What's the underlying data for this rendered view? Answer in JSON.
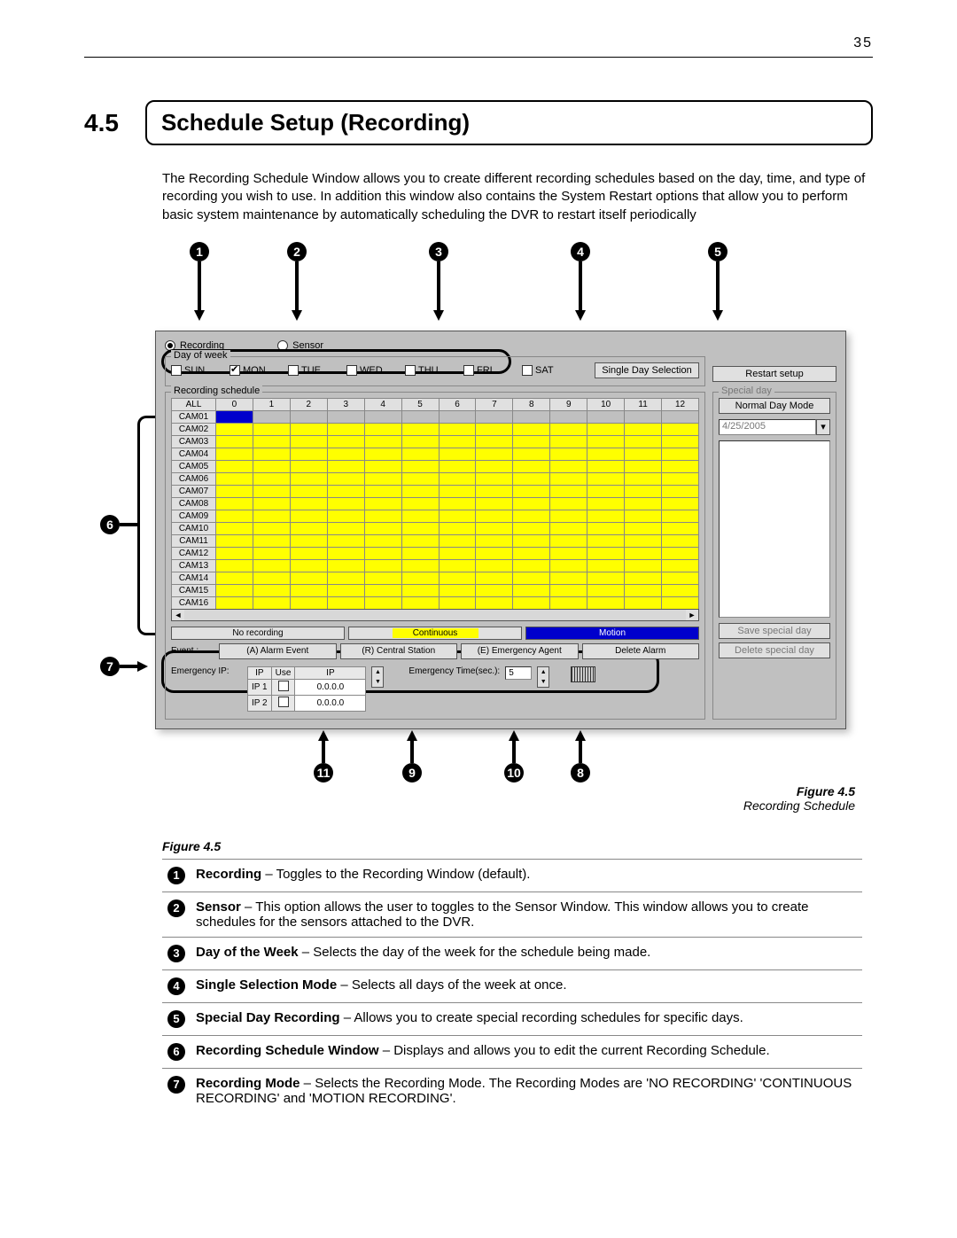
{
  "page_number": "35",
  "section_number": "4.5",
  "section_title": "Schedule Setup (Recording)",
  "intro": "The Recording Schedule Window allows you to create different recording schedules based on the day, time, and type of recording you wish to use. In addition this window also contains the System Restart options that allow you to perform basic system maintenance by automatically scheduling the DVR to restart itself periodically",
  "callout_nums_top": {
    "c1": "1",
    "c2": "2",
    "c3": "3",
    "c4": "4",
    "c5": "5"
  },
  "callout_nums_left": {
    "c6": "6",
    "c7": "7"
  },
  "callout_nums_bottom": {
    "c11": "11",
    "c9": "9",
    "c10": "10",
    "c8": "8"
  },
  "window": {
    "radio_recording": "Recording",
    "radio_sensor": "Sensor",
    "group_day": "Day of week",
    "days": {
      "sun": "SUN",
      "mon": "MON",
      "tue": "TUE",
      "wed": "WED",
      "thu": "THU",
      "fri": "FRI",
      "sat": "SAT"
    },
    "mon_checked": true,
    "btn_single_day": "Single Day Selection",
    "btn_restart": "Restart setup",
    "group_schedule": "Recording schedule",
    "group_special": "Special day",
    "btn_normal_day": "Normal Day Mode",
    "date": "4/25/2005",
    "btn_save_special": "Save special day",
    "btn_delete_special": "Delete special day",
    "cam_all": "ALL",
    "cams": [
      "CAM01",
      "CAM02",
      "CAM03",
      "CAM04",
      "CAM05",
      "CAM06",
      "CAM07",
      "CAM08",
      "CAM09",
      "CAM10",
      "CAM11",
      "CAM12",
      "CAM13",
      "CAM14",
      "CAM15",
      "CAM16"
    ],
    "hours": [
      "0",
      "1",
      "2",
      "3",
      "4",
      "5",
      "6",
      "7",
      "8",
      "9",
      "10",
      "11",
      "12"
    ],
    "legend_norec": "No recording",
    "legend_cont": "Continuous",
    "legend_motion": "Motion",
    "event_label": "Event :",
    "btn_alarm_event": "(A) Alarm Event",
    "btn_central_station": "(R) Central Station",
    "btn_emergency_agent": "(E) Emergency Agent",
    "btn_delete_alarm": "Delete Alarm",
    "emergency_ip_label": "Emergency IP:",
    "ip_hdr_ip": "IP",
    "ip_hdr_use": "Use",
    "ip_hdr_ip2": "IP",
    "ip1": "IP 1",
    "ip2": "IP 2",
    "ip_addr": "0.0.0.0",
    "emergency_time_label": "Emergency Time(sec.):",
    "emergency_time_value": "5"
  },
  "figure_caption_num": "Figure 4.5",
  "figure_caption_text": "Recording Schedule",
  "figure_label_left": "Figure 4.5",
  "legend": [
    {
      "n": "1",
      "b": "Recording",
      "t": " – Toggles to the Recording Window (default)."
    },
    {
      "n": "2",
      "b": "Sensor",
      "t": " – This option allows the user to toggles to the Sensor Window. This window allows you to create schedules for the sensors attached to the DVR."
    },
    {
      "n": "3",
      "b": "Day of the Week",
      "t": " – Selects the day of the week for the schedule being made."
    },
    {
      "n": "4",
      "b": "Single Selection Mode",
      "t": " – Selects all days of the week at once."
    },
    {
      "n": "5",
      "b": "Special Day Recording",
      "t": " – Allows you to create special recording schedules for specific days."
    },
    {
      "n": "6",
      "b": "Recording Schedule Window",
      "t": " – Displays and allows you to edit the current Recording Schedule."
    },
    {
      "n": "7",
      "b": "Recording Mode",
      "t": " – Selects the Recording Mode. The Recording Modes are 'NO RECORDING' 'CONTINUOUS RECORDING' and 'MOTION RECORDING'."
    }
  ]
}
